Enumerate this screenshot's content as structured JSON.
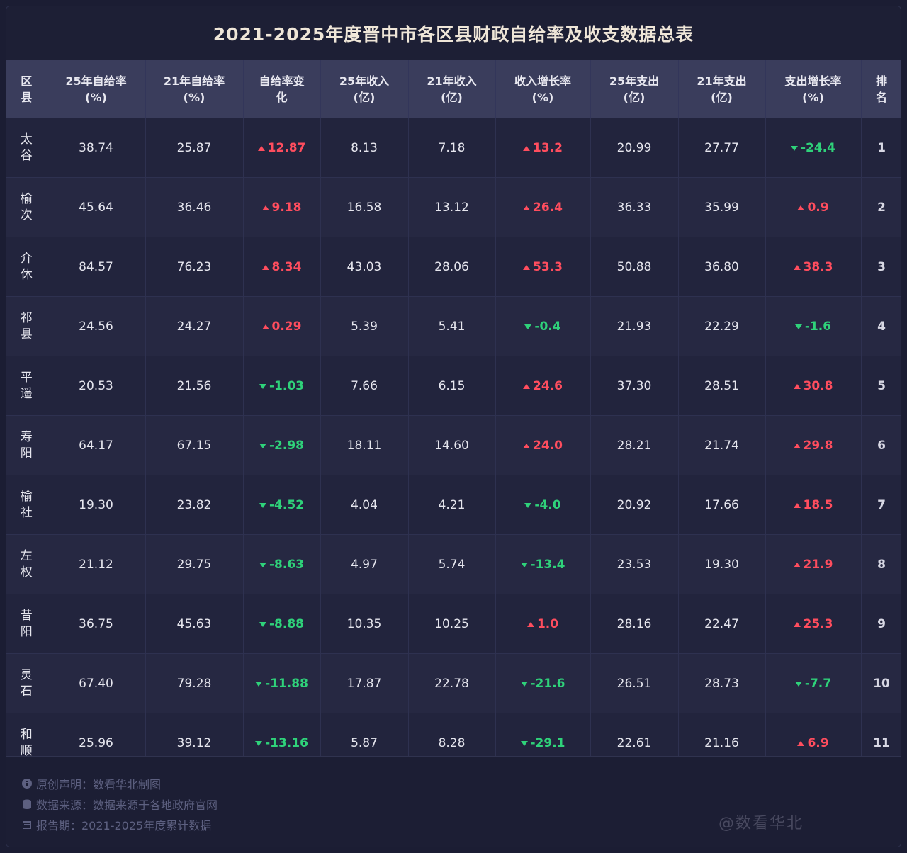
{
  "title": "2021-2025年度晋中市各区县财政自给率及收支数据总表",
  "headers": [
    [
      "区",
      "县"
    ],
    [
      "25年自给率",
      "(%)"
    ],
    [
      "21年自给率",
      "(%)"
    ],
    [
      "自给率变",
      "化"
    ],
    [
      "25年收入",
      "(亿)"
    ],
    [
      "21年收入",
      "(亿)"
    ],
    [
      "收入增长率",
      "(%)"
    ],
    [
      "25年支出",
      "(亿)"
    ],
    [
      "21年支出",
      "(亿)"
    ],
    [
      "支出增长率",
      "(%)"
    ],
    [
      "排",
      "名"
    ]
  ],
  "rows": [
    {
      "district": [
        "太",
        "谷"
      ],
      "r25": "38.74",
      "r21": "25.87",
      "rchg": {
        "dir": "up",
        "val": "12.87"
      },
      "inc25": "8.13",
      "inc21": "7.18",
      "incg": {
        "dir": "up",
        "val": "13.2"
      },
      "exp25": "20.99",
      "exp21": "27.77",
      "expg": {
        "dir": "down",
        "val": "-24.4"
      },
      "rank": "1"
    },
    {
      "district": [
        "榆",
        "次"
      ],
      "r25": "45.64",
      "r21": "36.46",
      "rchg": {
        "dir": "up",
        "val": "9.18"
      },
      "inc25": "16.58",
      "inc21": "13.12",
      "incg": {
        "dir": "up",
        "val": "26.4"
      },
      "exp25": "36.33",
      "exp21": "35.99",
      "expg": {
        "dir": "up",
        "val": "0.9"
      },
      "rank": "2"
    },
    {
      "district": [
        "介",
        "休"
      ],
      "r25": "84.57",
      "r21": "76.23",
      "rchg": {
        "dir": "up",
        "val": "8.34"
      },
      "inc25": "43.03",
      "inc21": "28.06",
      "incg": {
        "dir": "up",
        "val": "53.3"
      },
      "exp25": "50.88",
      "exp21": "36.80",
      "expg": {
        "dir": "up",
        "val": "38.3"
      },
      "rank": "3"
    },
    {
      "district": [
        "祁",
        "县"
      ],
      "r25": "24.56",
      "r21": "24.27",
      "rchg": {
        "dir": "up",
        "val": "0.29"
      },
      "inc25": "5.39",
      "inc21": "5.41",
      "incg": {
        "dir": "down",
        "val": "-0.4"
      },
      "exp25": "21.93",
      "exp21": "22.29",
      "expg": {
        "dir": "down",
        "val": "-1.6"
      },
      "rank": "4"
    },
    {
      "district": [
        "平",
        "遥"
      ],
      "r25": "20.53",
      "r21": "21.56",
      "rchg": {
        "dir": "down",
        "val": "-1.03"
      },
      "inc25": "7.66",
      "inc21": "6.15",
      "incg": {
        "dir": "up",
        "val": "24.6"
      },
      "exp25": "37.30",
      "exp21": "28.51",
      "expg": {
        "dir": "up",
        "val": "30.8"
      },
      "rank": "5"
    },
    {
      "district": [
        "寿",
        "阳"
      ],
      "r25": "64.17",
      "r21": "67.15",
      "rchg": {
        "dir": "down",
        "val": "-2.98"
      },
      "inc25": "18.11",
      "inc21": "14.60",
      "incg": {
        "dir": "up",
        "val": "24.0"
      },
      "exp25": "28.21",
      "exp21": "21.74",
      "expg": {
        "dir": "up",
        "val": "29.8"
      },
      "rank": "6"
    },
    {
      "district": [
        "榆",
        "社"
      ],
      "r25": "19.30",
      "r21": "23.82",
      "rchg": {
        "dir": "down",
        "val": "-4.52"
      },
      "inc25": "4.04",
      "inc21": "4.21",
      "incg": {
        "dir": "down",
        "val": "-4.0"
      },
      "exp25": "20.92",
      "exp21": "17.66",
      "expg": {
        "dir": "up",
        "val": "18.5"
      },
      "rank": "7"
    },
    {
      "district": [
        "左",
        "权"
      ],
      "r25": "21.12",
      "r21": "29.75",
      "rchg": {
        "dir": "down",
        "val": "-8.63"
      },
      "inc25": "4.97",
      "inc21": "5.74",
      "incg": {
        "dir": "down",
        "val": "-13.4"
      },
      "exp25": "23.53",
      "exp21": "19.30",
      "expg": {
        "dir": "up",
        "val": "21.9"
      },
      "rank": "8"
    },
    {
      "district": [
        "昔",
        "阳"
      ],
      "r25": "36.75",
      "r21": "45.63",
      "rchg": {
        "dir": "down",
        "val": "-8.88"
      },
      "inc25": "10.35",
      "inc21": "10.25",
      "incg": {
        "dir": "up",
        "val": "1.0"
      },
      "exp25": "28.16",
      "exp21": "22.47",
      "expg": {
        "dir": "up",
        "val": "25.3"
      },
      "rank": "9"
    },
    {
      "district": [
        "灵",
        "石"
      ],
      "r25": "67.40",
      "r21": "79.28",
      "rchg": {
        "dir": "down",
        "val": "-11.88"
      },
      "inc25": "17.87",
      "inc21": "22.78",
      "incg": {
        "dir": "down",
        "val": "-21.6"
      },
      "exp25": "26.51",
      "exp21": "28.73",
      "expg": {
        "dir": "down",
        "val": "-7.7"
      },
      "rank": "10"
    },
    {
      "district": [
        "和",
        "顺"
      ],
      "r25": "25.96",
      "r21": "39.12",
      "rchg": {
        "dir": "down",
        "val": "-13.16"
      },
      "inc25": "5.87",
      "inc21": "8.28",
      "incg": {
        "dir": "down",
        "val": "-29.1"
      },
      "exp25": "22.61",
      "exp21": "21.16",
      "expg": {
        "dir": "up",
        "val": "6.9"
      },
      "rank": "11"
    }
  ],
  "footer": {
    "notes": [
      {
        "icon": "info-icon",
        "text": "原创声明：数看华北制图"
      },
      {
        "icon": "database-icon",
        "text": "数据来源：数据来源于各地政府官网"
      },
      {
        "icon": "calendar-icon",
        "text": "报告期：2021-2025年度累计数据"
      }
    ],
    "watermark": "@数看华北"
  },
  "colors": {
    "up": "#ff4d5e",
    "down": "#2fd27a",
    "header_bg": "#3a3d5c",
    "title": "#efe6d8"
  }
}
